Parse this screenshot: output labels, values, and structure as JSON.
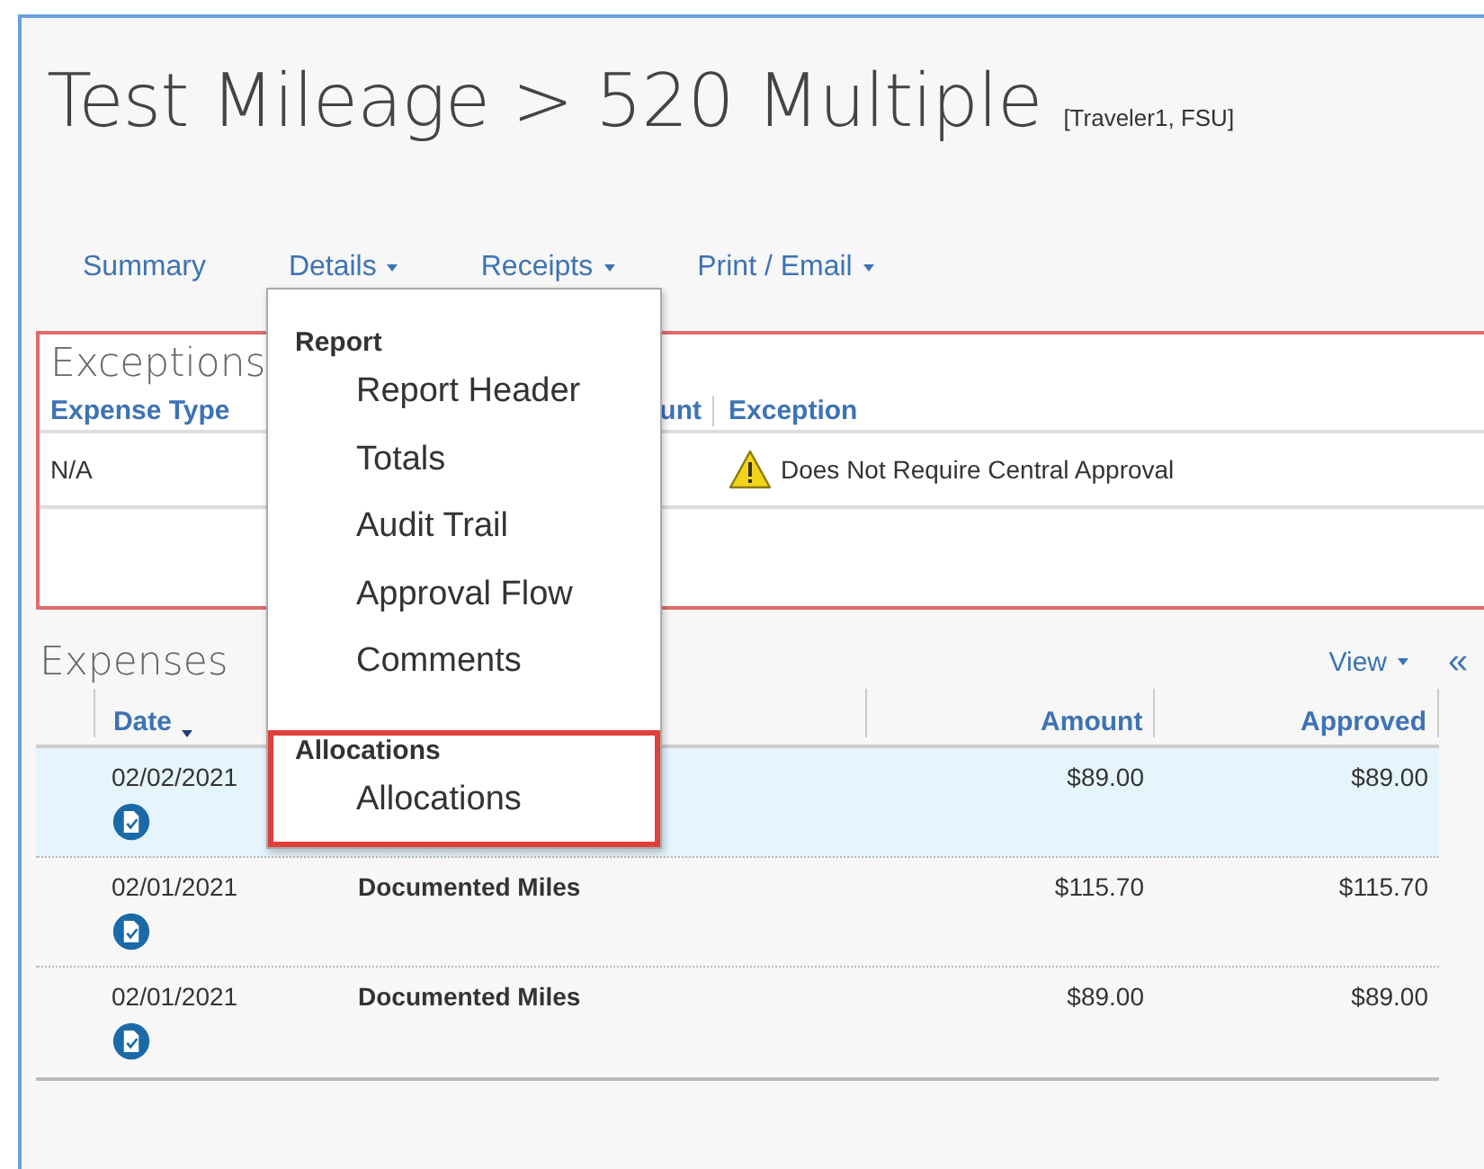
{
  "title": "Test Mileage > 520 Multiple",
  "subtitle": "[Traveler1, FSU]",
  "tabs": [
    {
      "label": "Summary",
      "caret": false
    },
    {
      "label": "Details",
      "caret": true
    },
    {
      "label": "Receipts",
      "caret": true
    },
    {
      "label": "Print / Email",
      "caret": true
    }
  ],
  "exceptions": {
    "title": "Exceptions",
    "columns": [
      "Expense Type",
      "unt",
      "Exception"
    ],
    "rows": [
      {
        "expense_type": "N/A",
        "exception": "Does Not Require Central Approval",
        "kind": "warning"
      }
    ]
  },
  "expenses": {
    "title": "Expenses",
    "view": "View",
    "collapse": "«",
    "columns": [
      "Date",
      "Amount",
      "Approved"
    ],
    "rows": [
      {
        "date": "02/02/2021",
        "amount": "$89.00",
        "approved": "$89.00",
        "selected": true
      },
      {
        "date": "02/01/2021",
        "type": "Documented Miles",
        "amount": "$115.70",
        "approved": "$115.70",
        "selected": false
      },
      {
        "date": "02/01/2021",
        "type": "Documented Miles",
        "amount": "$89.00",
        "approved": "$89.00",
        "selected": false
      }
    ]
  },
  "details_menu": [
    {
      "heading": "Report",
      "highlighted": false,
      "items": [
        "Report Header",
        "Totals",
        "Audit Trail",
        "Approval Flow",
        "Comments"
      ]
    },
    {
      "heading": "Allocations",
      "highlighted": true,
      "items": [
        "Allocations"
      ]
    }
  ]
}
